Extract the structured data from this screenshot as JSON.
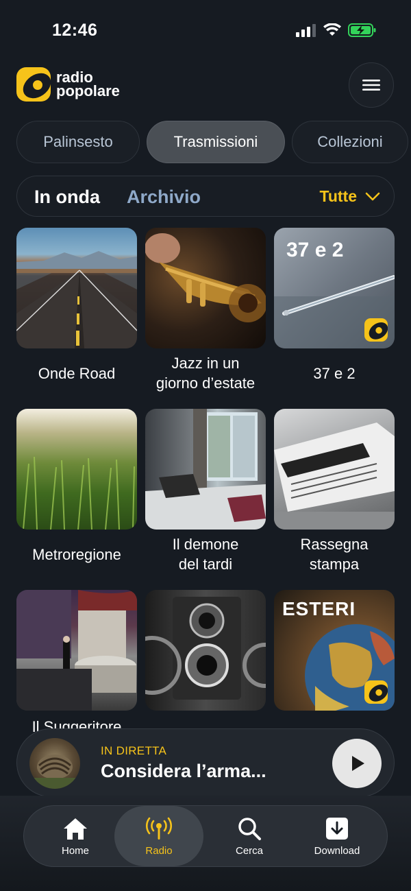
{
  "status_bar": {
    "time": "12:46",
    "icons": [
      "signal-icon",
      "wifi-icon",
      "battery-charging-icon"
    ]
  },
  "header": {
    "logo_line1": "radio",
    "logo_line2": "popolare",
    "menu_icon": "hamburger-menu-icon"
  },
  "tabs": [
    {
      "label": "Palinsesto",
      "active": false
    },
    {
      "label": "Trasmissioni",
      "active": true
    },
    {
      "label": "Collezioni",
      "active": false
    }
  ],
  "filter": {
    "in_onda": "In onda",
    "archivio": "Archivio",
    "tutte": "Tutte"
  },
  "programs": [
    {
      "title_line1": "Onde Road",
      "title_line2": ""
    },
    {
      "title_line1": "Jazz in un",
      "title_line2": "giorno d’estate"
    },
    {
      "title_line1": "37 e 2",
      "title_line2": "",
      "overlay": "37 e 2"
    },
    {
      "title_line1": "Metroregione",
      "title_line2": ""
    },
    {
      "title_line1": "Il demone",
      "title_line2": "del tardi"
    },
    {
      "title_line1": "Rassegna",
      "title_line2": "stampa"
    },
    {
      "title_line1": "Il Suggeritore",
      "title_line2": ""
    },
    {
      "title_line1": "",
      "title_line2": ""
    },
    {
      "title_line1": "",
      "title_line2": "",
      "overlay": "ESTERI"
    }
  ],
  "now_playing": {
    "label": "IN DIRETTA",
    "title": "Considera l’arma..."
  },
  "tabbar": [
    {
      "label": "Home",
      "icon": "home-icon",
      "active": false
    },
    {
      "label": "Radio",
      "icon": "radio-antenna-icon",
      "active": true
    },
    {
      "label": "Cerca",
      "icon": "search-icon",
      "active": false
    },
    {
      "label": "Download",
      "icon": "download-icon",
      "active": false
    }
  ],
  "colors": {
    "background": "#161b22",
    "accent": "#f6c31a",
    "archivio": "#8fa9c9"
  }
}
